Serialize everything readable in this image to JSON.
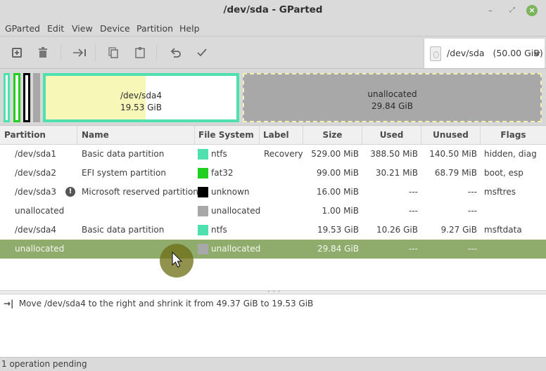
{
  "window": {
    "title": "/dev/sda - GParted",
    "minimize_glyph": "–",
    "maximize_glyph": "⤢",
    "close_glyph": "×"
  },
  "menubar": {
    "items": [
      "GParted",
      "Edit",
      "View",
      "Device",
      "Partition",
      "Help"
    ]
  },
  "toolbar": {
    "buttons": [
      {
        "name": "new-partition",
        "icon": "plus-box-icon"
      },
      {
        "name": "delete-partition",
        "icon": "trash-icon"
      },
      {
        "name": "resize-move",
        "icon": "arrow-to-bar-icon"
      },
      {
        "name": "copy",
        "icon": "copy-icon"
      },
      {
        "name": "paste",
        "icon": "clipboard-icon"
      },
      {
        "name": "undo",
        "icon": "undo-icon"
      },
      {
        "name": "apply",
        "icon": "checkmark-icon"
      }
    ],
    "device_selector": {
      "label": "/dev/sda   (50.00 GiB)",
      "icon": "harddisk-icon"
    }
  },
  "diskmap": {
    "sda4": {
      "name": "/dev/sda4",
      "size": "19.53 GiB",
      "used_fraction": 0.525
    },
    "unallocated": {
      "name": "unallocated",
      "size": "29.84 GiB"
    }
  },
  "colors": {
    "ntfs": "#4fe0b0",
    "fat32": "#20d020",
    "unknown": "#000000",
    "unallocated": "#a8a8a8",
    "selected_row": "#8fac6d",
    "used_space": "#f7f7b8"
  },
  "table": {
    "columns": [
      "Partition",
      "Name",
      "File System",
      "Label",
      "Size",
      "Used",
      "Unused",
      "Flags"
    ],
    "rows": [
      {
        "partition": "/dev/sda1",
        "name": "Basic data partition",
        "fs": "ntfs",
        "fs_color": "#4fe0b0",
        "label": "Recovery",
        "size": "529.00 MiB",
        "used": "388.50 MiB",
        "unused": "140.50 MiB",
        "flags": "hidden, diag",
        "warning": false
      },
      {
        "partition": "/dev/sda2",
        "name": "EFI system partition",
        "fs": "fat32",
        "fs_color": "#20d020",
        "label": "",
        "size": "99.00 MiB",
        "used": "30.21 MiB",
        "unused": "68.79 MiB",
        "flags": "boot, esp",
        "warning": false
      },
      {
        "partition": "/dev/sda3",
        "name": "Microsoft reserved partition",
        "fs": "unknown",
        "fs_color": "#000000",
        "label": "",
        "size": "16.00 MiB",
        "used": "---",
        "unused": "---",
        "flags": "msftres",
        "warning": true
      },
      {
        "partition": "unallocated",
        "name": "",
        "fs": "unallocated",
        "fs_color": "#a8a8a8",
        "label": "",
        "size": "1.00 MiB",
        "used": "---",
        "unused": "---",
        "flags": "",
        "warning": false
      },
      {
        "partition": "/dev/sda4",
        "name": "Basic data partition",
        "fs": "ntfs",
        "fs_color": "#4fe0b0",
        "label": "",
        "size": "19.53 GiB",
        "used": "10.26 GiB",
        "unused": "9.27 GiB",
        "flags": "msftdata",
        "warning": false
      },
      {
        "partition": "unallocated",
        "name": "",
        "fs": "unallocated",
        "fs_color": "#a8a8a8",
        "label": "",
        "size": "29.84 GiB",
        "used": "---",
        "unused": "---",
        "flags": "",
        "warning": false,
        "selected": true
      }
    ]
  },
  "operations": {
    "items": [
      {
        "icon": "→|",
        "text": "Move /dev/sda4 to the right and shrink it from 49.37 GiB to 19.53 GiB"
      }
    ]
  },
  "statusbar": {
    "text": "1 operation pending"
  }
}
